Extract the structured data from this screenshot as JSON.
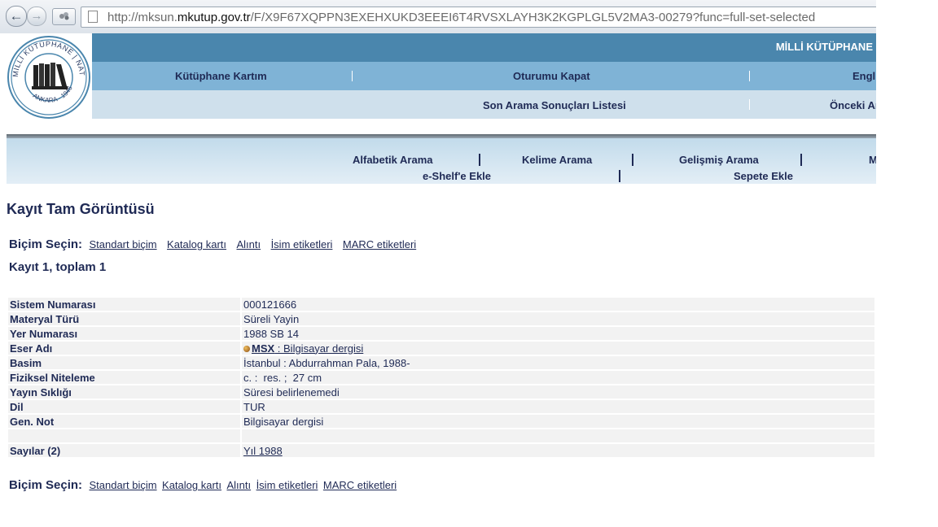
{
  "browser": {
    "back_glyph": "←",
    "forward_glyph": "→",
    "url_prefix": "http://mksun.",
    "url_domain": "mkutup.gov.tr",
    "url_suffix": "/F/X9F67XQPPN3EXEHXUKD3EEEI6T4RVSXLAYH3K2KGPLGL5V2MA3-00279?func=full-set-selected"
  },
  "header": {
    "brand": "MİLLİ KÜTÜPHANE",
    "logo_text": "MİLLİ KÜTÜPHANE | NATIONAL LIBRARY",
    "logo_subtext": "ANKARA · 1946",
    "row2_links": [
      "Kütüphane Kartım",
      "Oturumu Kapat",
      "Engli"
    ],
    "row3_links": [
      "Son Arama Sonuçları Listesi",
      "Önceki Ar"
    ]
  },
  "secondary_nav": {
    "row1": [
      "Alfabetik Arama",
      "Kelime Arama",
      "Gelişmiş Arama",
      "M"
    ],
    "row2": [
      "e-Shelf'e Ekle",
      "Sepete Ekle"
    ]
  },
  "page_title": "Kayıt Tam Görüntüsü",
  "format_select": {
    "label": "Biçim Seçin:",
    "options": [
      "Standart biçim",
      "Katalog kartı",
      "Alıntı",
      "İsim etiketleri",
      "MARC etiketleri"
    ]
  },
  "record_count": "Kayıt 1, toplam 1",
  "record": {
    "rows": [
      {
        "label": "Sistem Numarası",
        "value": "000121666"
      },
      {
        "label": "Materyal Türü",
        "value": "Süreli Yayin"
      },
      {
        "label": "Yer Numarası",
        "value": "1988 SB 14"
      },
      {
        "label": "Eser Adı",
        "value_link": "MSX",
        "value_rest": " : Bilgisayar dergisi"
      },
      {
        "label": "Basim",
        "value": "İstanbul : Abdurrahman Pala, 1988-"
      },
      {
        "label": "Fiziksel Niteleme",
        "value": "c. :  res. ;  27 cm"
      },
      {
        "label": "Yayın Sıklığı",
        "value": "Süresi belirlenemedi"
      },
      {
        "label": "Dil",
        "value": "TUR"
      },
      {
        "label": "Gen. Not",
        "value": "Bilgisayar dergisi"
      },
      {
        "label": "",
        "value": ""
      },
      {
        "label": "Sayılar (2)",
        "value_link": "Yıl 1988"
      }
    ]
  },
  "colors": {
    "header_dark": "#4a86ad",
    "header_mid": "#7fb3d6",
    "header_light": "#cfe0ec",
    "text": "#1f2a55"
  }
}
